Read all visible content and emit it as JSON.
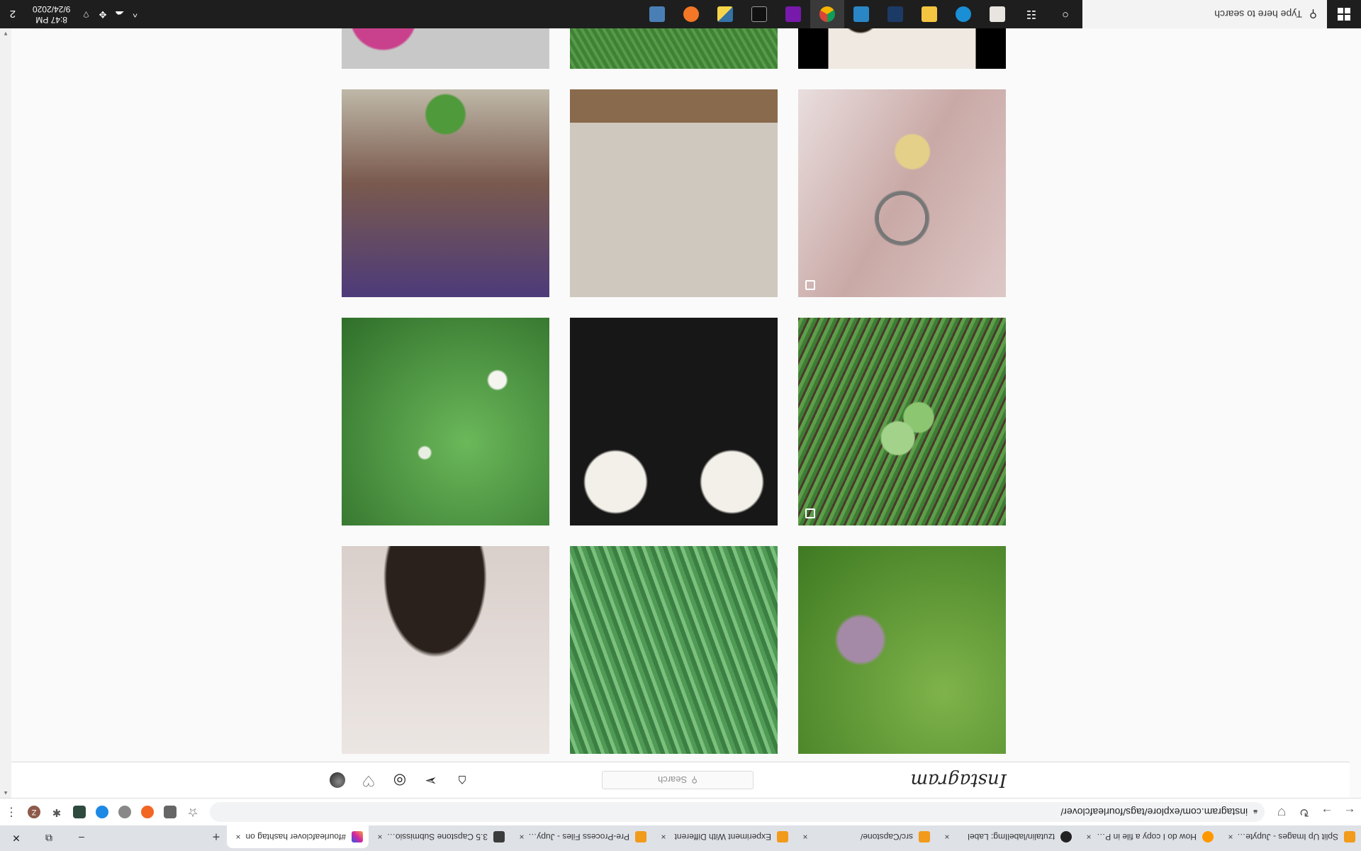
{
  "browser": {
    "tabs": [
      {
        "title": "#fourleafclover hashtag on",
        "close": "×",
        "icon": "instagram-favicon-icon",
        "active": true
      },
      {
        "title": "3.5 Capstone Submission - ",
        "close": "×",
        "icon": "jupyter-favicon-icon",
        "active": false
      },
      {
        "title": "Pre-Process Files - Jupyter",
        "close": "×",
        "icon": "jupyter-favicon-icon",
        "active": false
      },
      {
        "title": "Experiment With Different",
        "close": "×",
        "icon": "jupyter-favicon-icon",
        "active": false
      },
      {
        "title": "src/Capstone/",
        "close": "×",
        "icon": "jupyter-favicon-icon",
        "active": false
      },
      {
        "title": "tzutalin/labelImg: Label",
        "close": "×",
        "icon": "github-favicon-icon",
        "active": false
      },
      {
        "title": "How do I copy a file in Pyth",
        "close": "×",
        "icon": "stackoverflow-favicon-icon",
        "active": false
      },
      {
        "title": "Split Up Images - Jupyter N",
        "close": "×",
        "icon": "jupyter-favicon-icon",
        "active": false
      }
    ],
    "new_tab": "+",
    "window_controls": {
      "minimize": "–",
      "restore": "⧉",
      "close": "✕"
    },
    "nav": {
      "back": "←",
      "forward": "→",
      "reload": "↻"
    },
    "url": "instagram.com/explore/tags/fourleafclover/",
    "profile_initial": "Z",
    "menu": "⋮",
    "star": "☆"
  },
  "instagram": {
    "logo_text": "Instagram",
    "search_placeholder": "Search",
    "search_icon": "⚲",
    "nav_icons": {
      "home": "⌂",
      "direct": "➢",
      "explore": "◎",
      "activity": "♡"
    }
  },
  "grid": {
    "rows": [
      [
        {
          "name": "post-clover-purple-flower",
          "multi": false
        },
        {
          "name": "post-grass-clover",
          "multi": false
        },
        {
          "name": "post-portrait-live",
          "multi": false
        }
      ],
      [
        {
          "name": "post-clover-on-grass",
          "multi": true
        },
        {
          "name": "post-clover-earrings",
          "multi": false
        },
        {
          "name": "post-clover-patch-flowers",
          "multi": false
        }
      ],
      [
        {
          "name": "post-clover-keychain",
          "multi": true
        },
        {
          "name": "post-clover-drawing",
          "multi": false
        },
        {
          "name": "post-clover-house",
          "multi": false
        }
      ],
      [
        {
          "name": "post-flowers-book-coffee",
          "multi": false
        },
        {
          "name": "post-hand-holding-clover",
          "multi": false
        },
        {
          "name": "post-clover-coloring-page",
          "multi": false
        }
      ]
    ]
  },
  "taskbar": {
    "search_placeholder": "Type here to search",
    "time": "8:47 PM",
    "date": "9/24/2020",
    "notification_count": "2",
    "tray_expand": "^"
  },
  "colors": {
    "instagram_text": "#262626",
    "page_bg": "#fafafa",
    "taskbar_bg": "#1e1e1e"
  }
}
